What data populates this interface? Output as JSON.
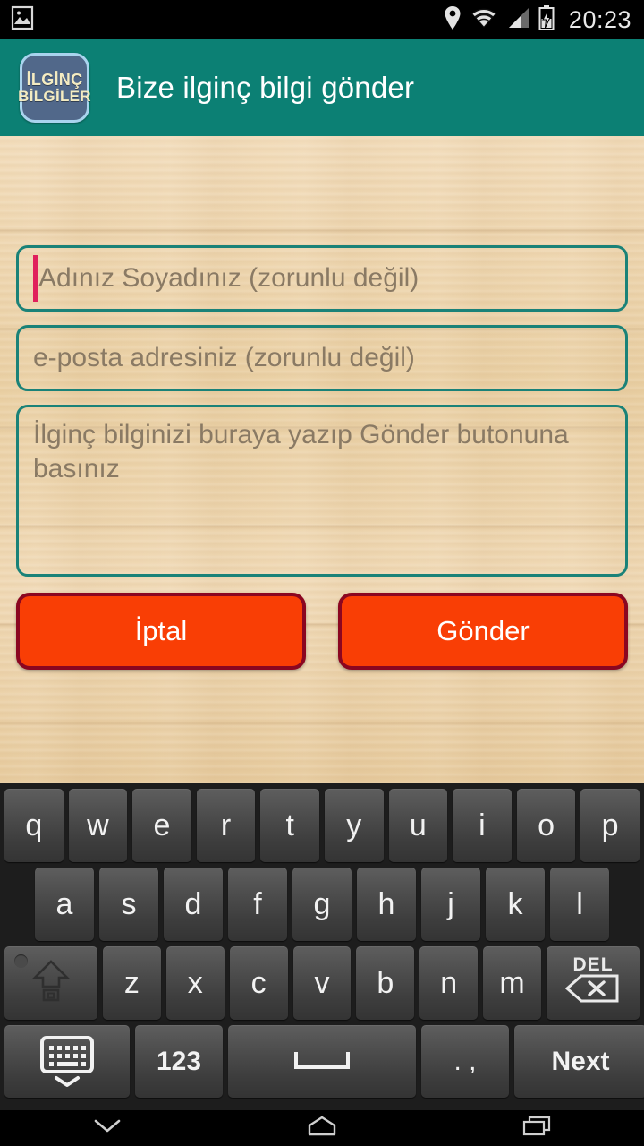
{
  "status_bar": {
    "notification_icon": "photo-icon",
    "icons": [
      "location-pin-icon",
      "wifi-icon",
      "cellular-signal-icon",
      "battery-charging-icon"
    ],
    "clock": "20:23"
  },
  "app_bar": {
    "logo_line1": "İLGİNÇ",
    "logo_line2": "BİLGİLER",
    "title": "Bize ilginç bilgi gönder",
    "background_color": "#0c8074"
  },
  "form": {
    "name_placeholder": "Adınız Soyadınız (zorunlu değil)",
    "name_value": "",
    "email_placeholder": "e-posta adresiniz (zorunlu değil)",
    "email_value": "",
    "message_placeholder": "İlginç bilginizi buraya yazıp Gönder butonuna basınız",
    "message_value": "",
    "field_border_color": "#1a8278",
    "cursor_color": "#e0215c",
    "cancel_label": "İptal",
    "send_label": "Gönder",
    "button_color": "#f93e05",
    "button_border_color": "#8b0620"
  },
  "keyboard": {
    "row1": [
      "q",
      "w",
      "e",
      "r",
      "t",
      "y",
      "u",
      "i",
      "o",
      "p"
    ],
    "row2": [
      "a",
      "s",
      "d",
      "f",
      "g",
      "h",
      "j",
      "k",
      "l"
    ],
    "row3": [
      "z",
      "x",
      "c",
      "v",
      "b",
      "n",
      "m"
    ],
    "shift_key": "shift-icon",
    "delete_key_label": "DEL",
    "delete_key_icon": "backspace-icon",
    "switch_keyboard_icon": "keyboard-icon",
    "symbols_key": "123",
    "space_key": "space-icon",
    "punctuation_key": ". ,",
    "action_key": "Next"
  },
  "nav_bar": {
    "back": "chevron-down-icon",
    "home": "home-icon",
    "recents": "recents-icon"
  }
}
